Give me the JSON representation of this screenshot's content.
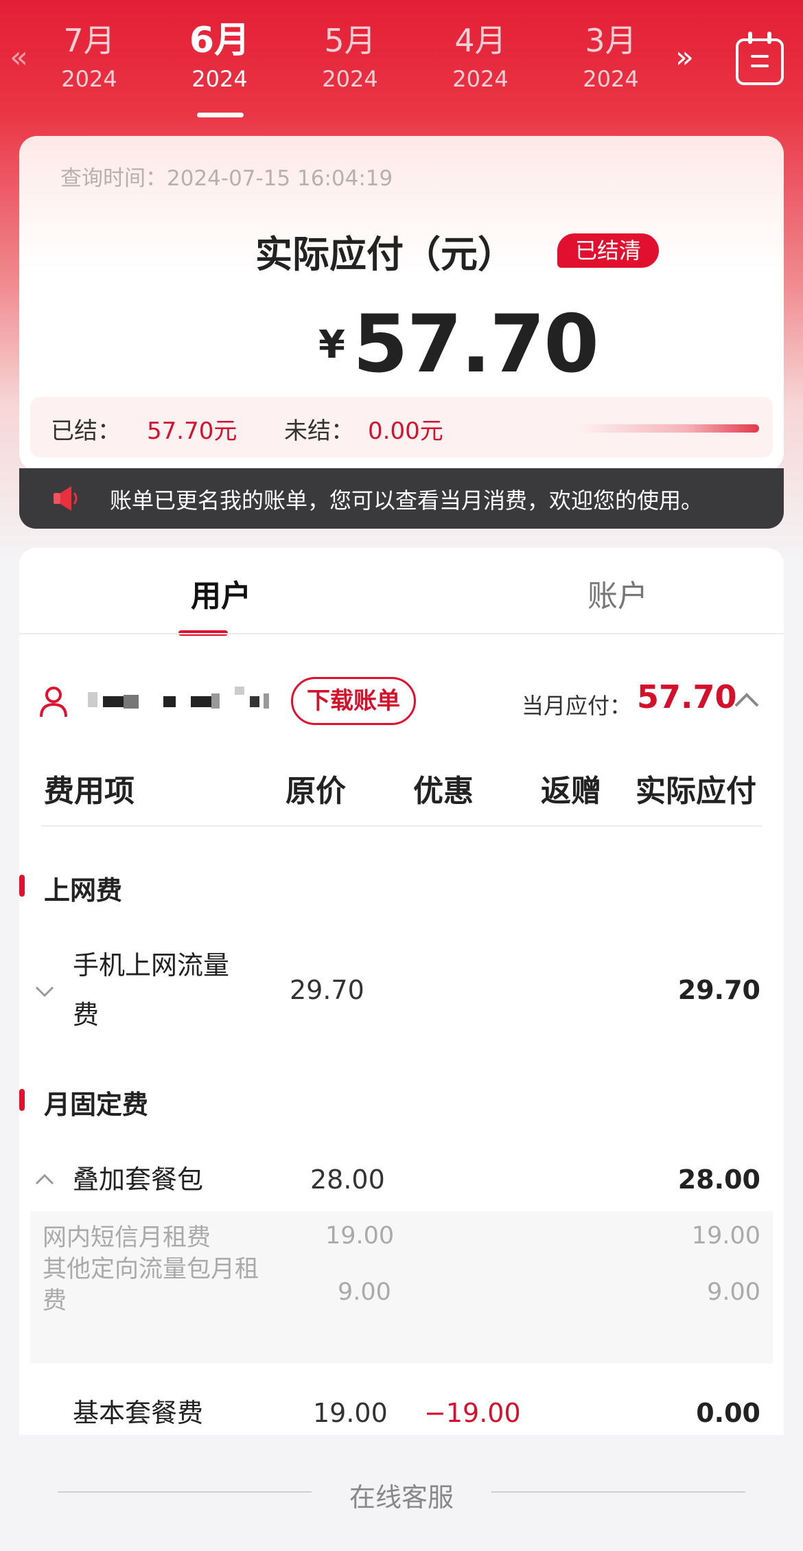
{
  "months": [
    {
      "m": "7月",
      "y": "2024"
    },
    {
      "m": "6月",
      "y": "2024"
    },
    {
      "m": "5月",
      "y": "2024"
    },
    {
      "m": "4月",
      "y": "2024"
    },
    {
      "m": "3月",
      "y": "2024"
    }
  ],
  "nav": {
    "prev_glyph": "«",
    "next_glyph": "»",
    "active_index": 1
  },
  "summary": {
    "query_time": "查询时间：2024-07-15 16:04:19",
    "title": "实际应付（元）",
    "badge": "已结清",
    "currency": "¥",
    "amount": "57.70",
    "settled_label": "已结：",
    "settled_value": "57.70元",
    "unsettled_label": "未结：",
    "unsettled_value": "0.00元"
  },
  "notice": {
    "text": "账单已更名我的账单，您可以查看当月消费，欢迎您的使用。"
  },
  "tabs": [
    {
      "label": "用户"
    },
    {
      "label": "账户"
    }
  ],
  "user_row": {
    "download": "下载账单",
    "month_pay_label": "当月应付：",
    "month_pay_value": "57.70"
  },
  "columns": [
    "费用项",
    "原价",
    "优惠",
    "返赠",
    "实际应付"
  ],
  "groups": [
    {
      "title": "上网费",
      "items": [
        {
          "name": "手机上网流量费",
          "original": "29.70",
          "discount": "",
          "gift": "",
          "final": "29.70",
          "expanded": false
        }
      ]
    },
    {
      "title": "月固定费",
      "items": [
        {
          "name": "叠加套餐包",
          "original": "28.00",
          "discount": "",
          "gift": "",
          "final": "28.00",
          "expanded": true,
          "details": [
            {
              "name": "网内短信月租费",
              "original": "19.00",
              "final": "19.00"
            },
            {
              "name": "其他定向流量包月租费",
              "original": "9.00",
              "final": "9.00"
            }
          ]
        },
        {
          "name": "基本套餐费",
          "original": "19.00",
          "discount": "−19.00",
          "gift": "",
          "final": "0.00",
          "expanded": false
        }
      ]
    }
  ],
  "footer": {
    "label": "在线客服"
  },
  "colors": {
    "accent": "#e0102e",
    "dark": "#3a3a3c"
  }
}
